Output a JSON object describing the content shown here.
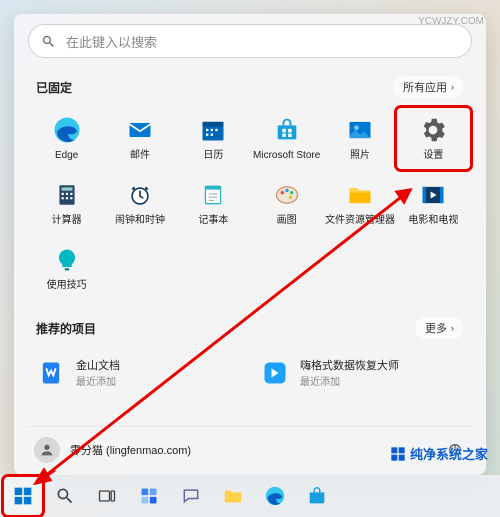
{
  "watermark": {
    "text": "纯净系统之家",
    "url": "YCWJZY.COM"
  },
  "search": {
    "placeholder": "在此键入以搜索"
  },
  "pinned": {
    "title": "已固定",
    "all_apps_label": "所有应用",
    "apps": [
      {
        "name": "Edge"
      },
      {
        "name": "邮件"
      },
      {
        "name": "日历"
      },
      {
        "name": "Microsoft Store"
      },
      {
        "name": "照片"
      },
      {
        "name": "设置"
      },
      {
        "name": "计算器"
      },
      {
        "name": "闹钟和时钟"
      },
      {
        "name": "记事本"
      },
      {
        "name": "画图"
      },
      {
        "name": "文件资源管理器"
      },
      {
        "name": "电影和电视"
      },
      {
        "name": "使用技巧"
      }
    ]
  },
  "recommended": {
    "title": "推荐的项目",
    "more_label": "更多",
    "items": [
      {
        "name": "金山文档",
        "sub": "最近添加"
      },
      {
        "name": "嗨格式数据恢复大师",
        "sub": "最近添加"
      }
    ]
  },
  "user": {
    "display": "零分猫 (lingfenmao.com)"
  },
  "taskbar": {
    "items": [
      "start",
      "search",
      "taskview",
      "widgets",
      "chat",
      "explorer",
      "edge",
      "store"
    ]
  }
}
